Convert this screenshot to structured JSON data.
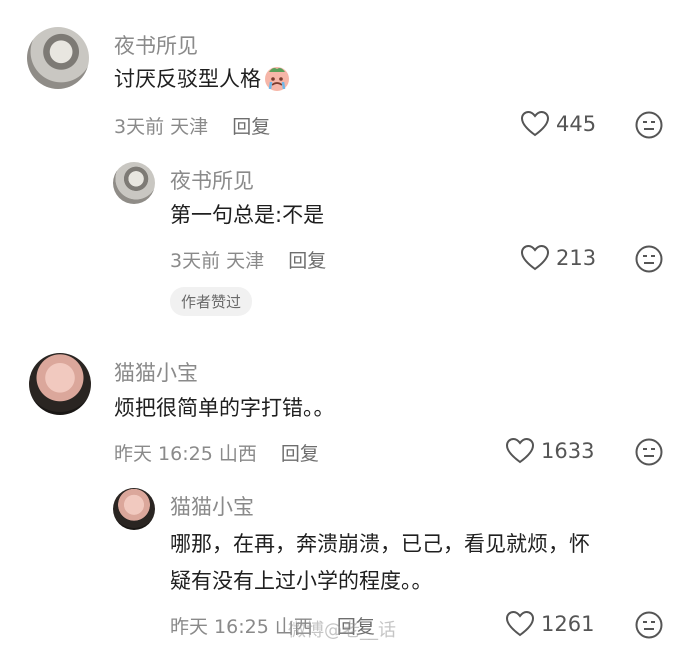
{
  "comments": [
    {
      "author": "夜书所见",
      "text": "讨厌反驳型人格",
      "emoji": "crying-face-emoji",
      "time": "3天前",
      "location": "天津",
      "reply_label": "回复",
      "likes": "445"
    },
    {
      "author": "夜书所见",
      "text": "第一句总是:不是",
      "time": "3天前",
      "location": "天津",
      "reply_label": "回复",
      "likes": "213",
      "badge": "作者赞过"
    },
    {
      "author": "猫猫小宝",
      "text": "烦把很简单的字打错。。",
      "time": "昨天 16:25",
      "location": "山西",
      "reply_label": "回复",
      "likes": "1633"
    },
    {
      "author": "猫猫小宝",
      "text_line1": "哪那，在再，奔溃崩溃，已己，看见就烦，怀",
      "text_line2": "疑有没有上过小学的程度。。",
      "time": "昨天 16:25",
      "location": "山西",
      "reply_label": "回复",
      "likes": "1261"
    }
  ],
  "watermark": "微博@老__话"
}
